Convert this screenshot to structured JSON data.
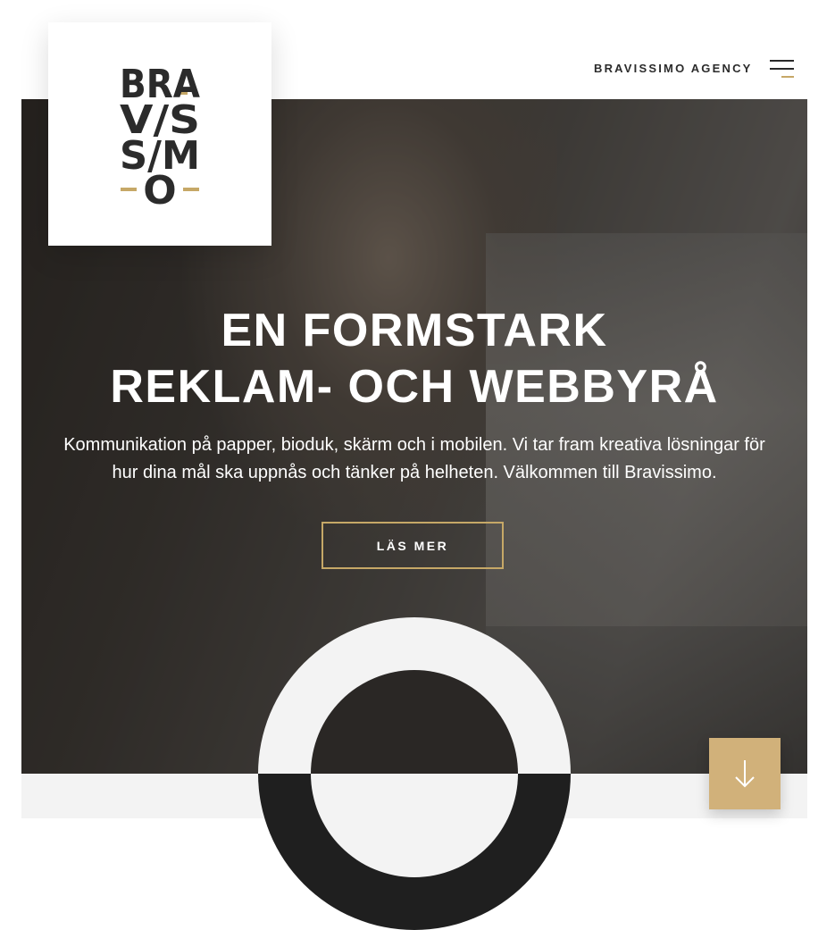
{
  "colors": {
    "accent": "#c6a867",
    "dark": "#2b2b2b",
    "band": "#f3f3f3",
    "scroll_button": "#d1b17a"
  },
  "logo": {
    "rows": [
      "BRA",
      "V/S",
      "S/M",
      "O"
    ],
    "icon": "bravissimo-logo"
  },
  "header": {
    "agency_name": "BRAVISSIMO AGENCY",
    "menu_icon": "hamburger-menu-icon"
  },
  "hero": {
    "title_line1": "EN FORMSTARK",
    "title_line2": "REKLAM- OCH WEBBYRÅ",
    "text": "Kommunikation på papper, bioduk, skärm och i mobilen. Vi tar fram kreativa lösningar för hur dina mål ska uppnås och tänker på helheten. Välkommen till Bravissimo.",
    "cta_label": "LÄS MER"
  },
  "scroll_button": {
    "icon": "arrow-down-icon"
  }
}
